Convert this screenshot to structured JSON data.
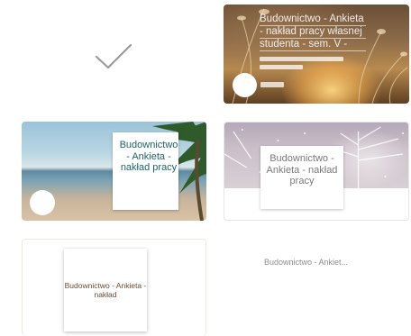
{
  "designs": {
    "sunset": {
      "lines": [
        "Budownictwo - Ankieta",
        "- nakład pracy własnej",
        "studenta - sem. V -"
      ]
    },
    "beach": {
      "title": "Budownictwo - Ankieta - nakład pracy"
    },
    "snow": {
      "title": "Budownictwo - Ankieta - nakład pracy"
    },
    "plain": {
      "title": "Budownictwo - Ankieta - nakład"
    },
    "text_only": {
      "title": "Budownictwo - Ankiet..."
    }
  },
  "icons": {
    "selected": "checkmark-icon"
  },
  "colors": {
    "beach_text": "#1f6468",
    "snow_text": "#7a7a7a",
    "plain_text": "#6b4a2f",
    "text_only": "#8c8c8c"
  }
}
